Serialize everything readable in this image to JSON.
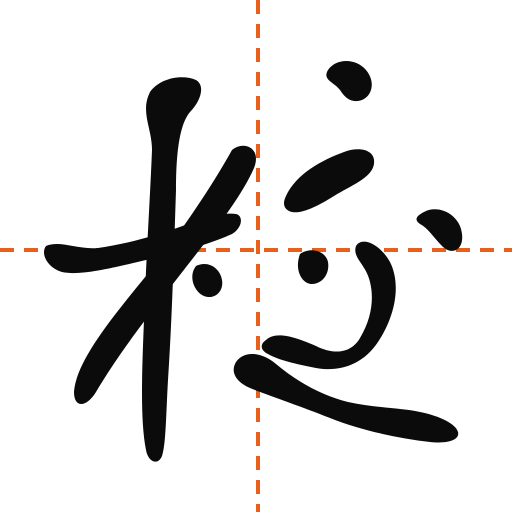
{
  "app_icon": {
    "character": "校",
    "description_name": "calligraphy-character-xiao",
    "guide_line_color": "#E8601C",
    "ink_color": "#0B0B0B",
    "background_color": "#FFFFFF",
    "icon_name": "calligraphy-practice-icon"
  }
}
